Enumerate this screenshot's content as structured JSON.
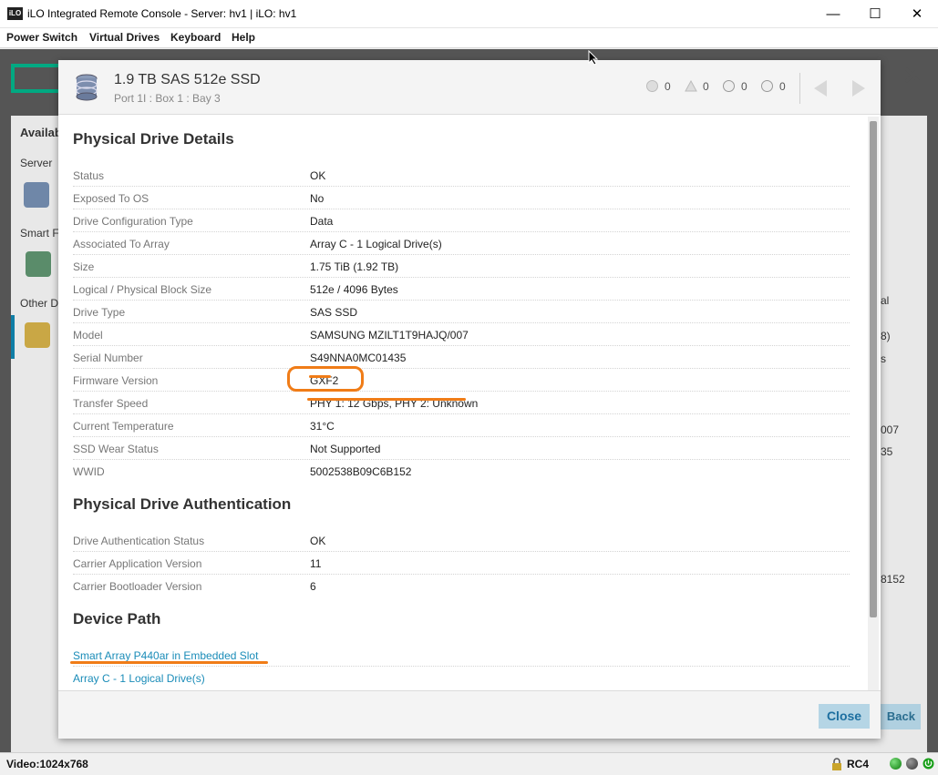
{
  "window": {
    "app_icon_text": "iLO",
    "title": "iLO Integrated Remote Console - Server: hv1 | iLO: hv1",
    "minimize": "—",
    "maximize": "☐",
    "close": "✕"
  },
  "menu": [
    "Power Switch",
    "Virtual Drives",
    "Keyboard",
    "Help"
  ],
  "background": {
    "available_label": "Availab",
    "server_label": "Server",
    "smart_label": "Smart F",
    "other_label": "Other D",
    "right_fragments": [
      "al",
      "8)",
      "s",
      "007",
      "35",
      "8152"
    ],
    "back_label": "Back",
    "close_glyph": "✕"
  },
  "dialog": {
    "title": "1.9 TB SAS 512e SSD",
    "subtitle": "Port 1I : Box 1 : Bay 3",
    "counts": [
      "0",
      "0",
      "0",
      "0"
    ],
    "sections": {
      "details_title": "Physical Drive Details",
      "details": [
        {
          "label": "Status",
          "value": "OK"
        },
        {
          "label": "Exposed To OS",
          "value": "No"
        },
        {
          "label": "Drive Configuration Type",
          "value": "Data"
        },
        {
          "label": "Associated To Array",
          "value": "Array C - 1 Logical Drive(s)"
        },
        {
          "label": "Size",
          "value": "1.75 TiB (1.92 TB)"
        },
        {
          "label": "Logical / Physical Block Size",
          "value": "512e / 4096 Bytes"
        },
        {
          "label": "Drive Type",
          "value": "SAS SSD"
        },
        {
          "label": "Model",
          "value": "SAMSUNG MZILT1T9HAJQ/007"
        },
        {
          "label": "Serial Number",
          "value": "S49NNA0MC01435"
        },
        {
          "label": "Firmware Version",
          "value": "GXF2"
        },
        {
          "label": "Transfer Speed",
          "value": "PHY 1: 12 Gbps, PHY 2: Unknown"
        },
        {
          "label": "Current Temperature",
          "value": "31°C"
        },
        {
          "label": "SSD Wear Status",
          "value": "Not Supported"
        },
        {
          "label": "WWID",
          "value": "5002538B09C6B152"
        }
      ],
      "auth_title": "Physical Drive Authentication",
      "auth": [
        {
          "label": "Drive Authentication Status",
          "value": "OK"
        },
        {
          "label": "Carrier Application Version",
          "value": "11"
        },
        {
          "label": "Carrier Bootloader Version",
          "value": "6"
        }
      ],
      "path_title": "Device Path",
      "path_links": [
        "Smart Array P440ar in Embedded Slot",
        "Array C - 1 Logical Drive(s)"
      ]
    },
    "close_label": "Close"
  },
  "statusbar": {
    "video": "Video:1024x768",
    "rc4": "RC4"
  },
  "colors": {
    "accent_link": "#1a8cb8",
    "annotation": "#f07c17",
    "hpe_green": "#01a982"
  }
}
